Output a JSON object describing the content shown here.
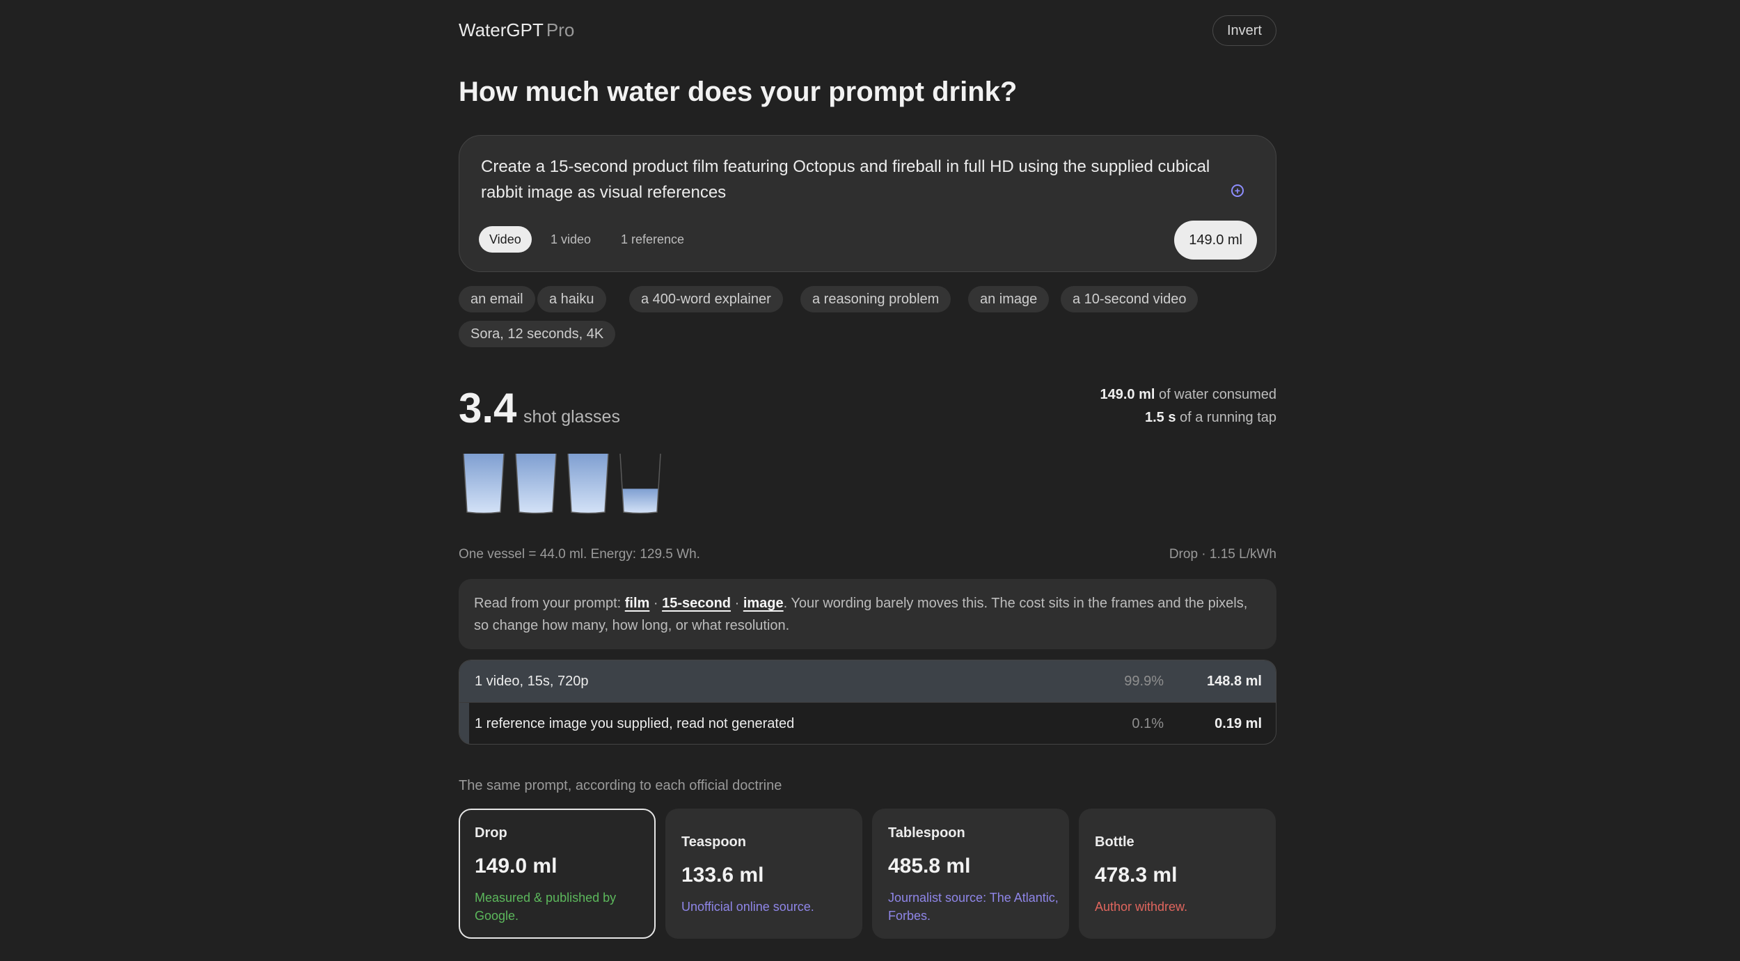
{
  "header": {
    "brand": "WaterGPT",
    "brand_suffix": "Pro",
    "invert_label": "Invert"
  },
  "title": "How much water does your prompt drink?",
  "prompt": {
    "text": "Create a 15-second product film featuring Octopus and fireball in full HD using the supplied cubical rabbit image as visual references",
    "icon": "add-circle-icon",
    "mode": "Video",
    "meta": [
      "1 video",
      "1 reference"
    ],
    "total": "149.0 ml"
  },
  "presets": [
    "an email",
    "a haiku",
    "a 400-word explainer",
    "a reasoning problem",
    "an image",
    "a 10-second video",
    "Sora, 12 seconds, 4K"
  ],
  "result": {
    "count": "3.4",
    "unit": "shot glasses",
    "consumed_value": "149.0 ml",
    "consumed_text": "of water consumed",
    "tap_value": "1.5 s",
    "tap_text": "of a running tap",
    "vessel_fills": [
      1,
      1,
      1,
      0.4
    ],
    "water_color": "#a9c6ef",
    "vessel_note": "One vessel = 44.0 ml. Energy: 129.5 Wh.",
    "doctrine_note": "Drop · 1.15 L/kWh"
  },
  "read": {
    "prefix": "Read from your prompt: ",
    "keywords": [
      "film",
      "15-second",
      "image"
    ],
    "separator": " · ",
    "suffix": ". Your wording barely moves this. The cost sits in the frames and the pixels, so change how many, how long, or what resolution."
  },
  "breakdown": [
    {
      "label": "1 video, 15s, 720p",
      "pct": "99.9%",
      "share": 0.999,
      "value": "148.8 ml"
    },
    {
      "label": "1 reference image you supplied, read not generated",
      "pct": "0.1%",
      "share": 0.001,
      "value": "0.19 ml"
    }
  ],
  "doctrines": {
    "label": "The same prompt, according to each official doctrine",
    "cards": [
      {
        "name": "Drop",
        "value": "149.0 ml",
        "source": "Measured & published by Google.",
        "source_color": "#5cb85c",
        "active": true
      },
      {
        "name": "Teaspoon",
        "value": "133.6 ml",
        "source": "Unofficial online source.",
        "source_color": "#8f86e8",
        "active": false
      },
      {
        "name": "Tablespoon",
        "value": "485.8 ml",
        "source": "Journalist source: The Atlantic, Forbes.",
        "source_color": "#8f86e8",
        "active": false
      },
      {
        "name": "Bottle",
        "value": "478.3 ml",
        "source": "Author withdrew.",
        "source_color": "#e0665e",
        "active": false
      }
    ]
  }
}
